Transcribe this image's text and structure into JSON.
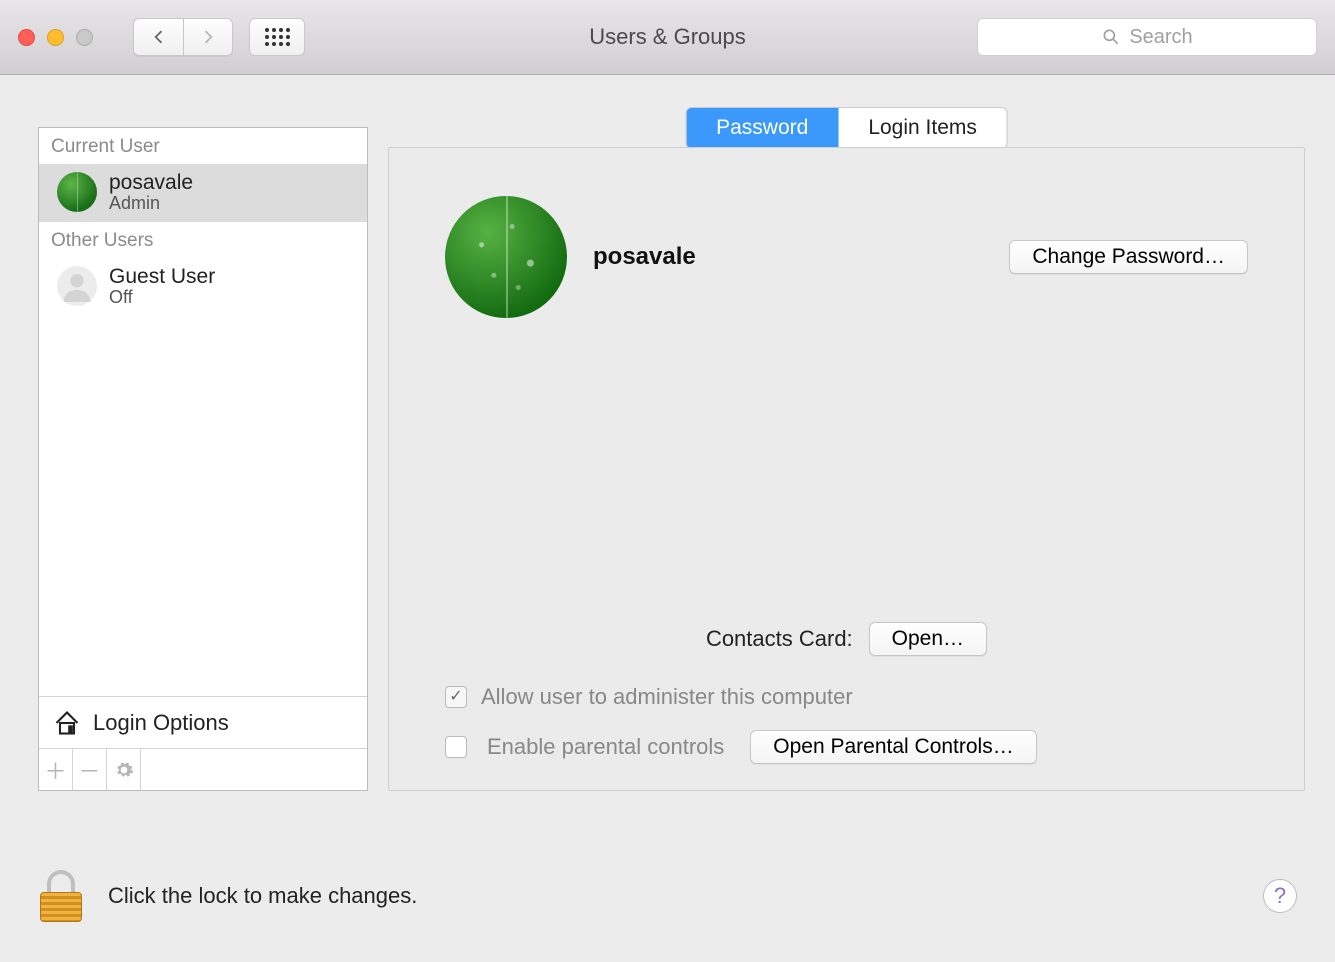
{
  "window": {
    "title": "Users & Groups",
    "search_placeholder": "Search"
  },
  "sidebar": {
    "current_user_label": "Current User",
    "other_users_label": "Other Users",
    "login_options_label": "Login Options",
    "current_user": {
      "name": "posavale",
      "role": "Admin"
    },
    "other_users": [
      {
        "name": "Guest User",
        "role": "Off"
      }
    ]
  },
  "tabs": {
    "password": "Password",
    "login_items": "Login Items"
  },
  "profile": {
    "name": "posavale",
    "change_password_label": "Change Password…"
  },
  "contacts": {
    "label": "Contacts Card:",
    "button": "Open…"
  },
  "admin_checkbox": {
    "label": "Allow user to administer this computer",
    "checked": true
  },
  "parental": {
    "checkbox_label": "Enable parental controls",
    "checked": false,
    "button": "Open Parental Controls…"
  },
  "footer": {
    "lock_text": "Click the lock to make changes."
  }
}
